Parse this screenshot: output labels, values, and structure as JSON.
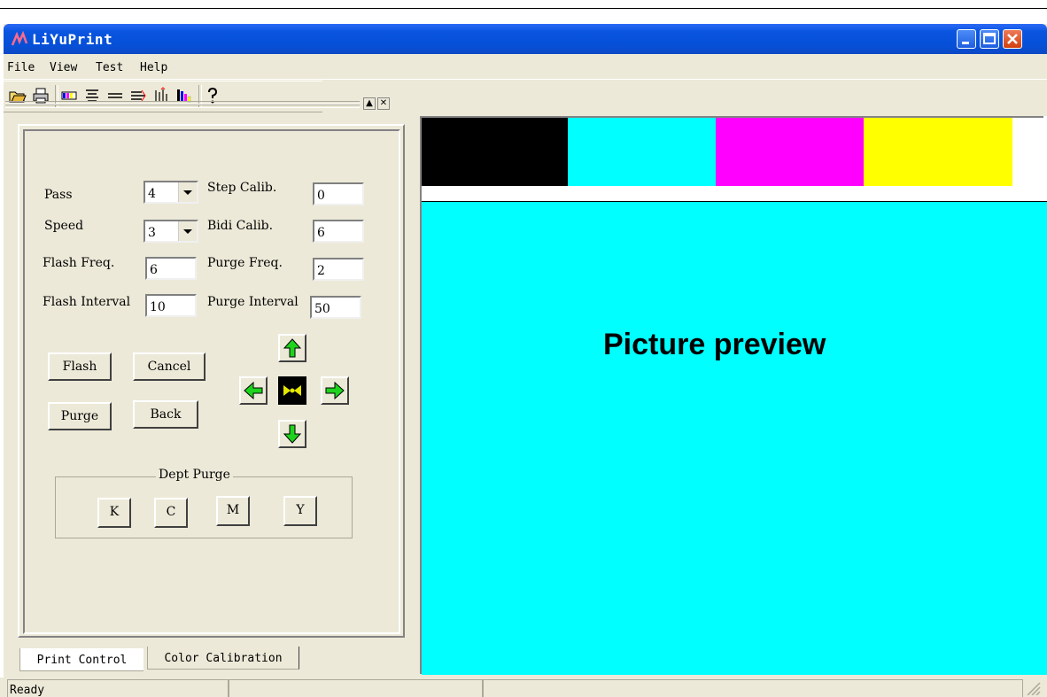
{
  "window": {
    "title": "LiYuPrint"
  },
  "menu": [
    "File",
    "View",
    "Test",
    "Help"
  ],
  "toolbar": [
    "open-icon",
    "print-icon",
    "color-bar-icon",
    "align-icon",
    "step-icon",
    "bidi-icon",
    "calib-icon",
    "ink-levels-icon",
    "help-icon"
  ],
  "panel": {
    "pass_label": "Pass",
    "pass_value": "4",
    "speed_label": "Speed",
    "speed_value": "3",
    "flash_freq_label": "Flash Freq.",
    "flash_freq_value": "6",
    "flash_interval_label": "Flash Interval",
    "flash_interval_value": "10",
    "step_calib_label": "Step Calib.",
    "step_calib_value": "0",
    "bidi_calib_label": "Bidi Calib.",
    "bidi_calib_value": "6",
    "purge_freq_label": "Purge Freq.",
    "purge_freq_value": "2",
    "purge_interval_label": "Purge Interval",
    "purge_interval_value": "50",
    "flash_btn": "Flash",
    "cancel_btn": "Cancel",
    "purge_btn": "Purge",
    "back_btn": "Back",
    "dept_purge_title": "Dept Purge",
    "k_btn": "K",
    "c_btn": "C",
    "m_btn": "M",
    "y_btn": "Y"
  },
  "tabs": {
    "print_control": "Print Control",
    "color_calibration": "Color Calibration"
  },
  "preview": {
    "label": "Picture preview",
    "colors": [
      "#000000",
      "#00ffff",
      "#ff00ff",
      "#ffff00"
    ]
  },
  "status": {
    "text": "Ready"
  }
}
